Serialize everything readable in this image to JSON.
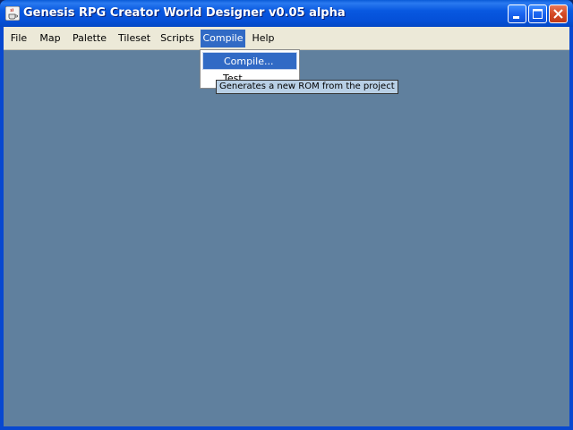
{
  "window": {
    "title": "Genesis RPG Creator World Designer v0.05 alpha",
    "app_icon": "java-cup-icon",
    "controls": {
      "minimize": "minimize-icon",
      "maximize": "maximize-icon",
      "close": "close-icon"
    }
  },
  "menubar": {
    "items": [
      {
        "label": "File"
      },
      {
        "label": "Map"
      },
      {
        "label": "Palette"
      },
      {
        "label": "Tileset"
      },
      {
        "label": "Scripts"
      },
      {
        "label": "Compile",
        "active": true
      },
      {
        "label": "Help"
      }
    ]
  },
  "compile_menu": {
    "items": [
      {
        "label": "Compile...",
        "highlighted": true
      },
      {
        "label": "Test"
      }
    ]
  },
  "tooltip": {
    "text": "Generates a new ROM from the project"
  },
  "colors": {
    "titlebar": "#0858e0",
    "menubar": "#ece9d8",
    "content_bg": "#60809e",
    "highlight": "#316ac5",
    "tooltip_bg": "#b8cfe5"
  }
}
